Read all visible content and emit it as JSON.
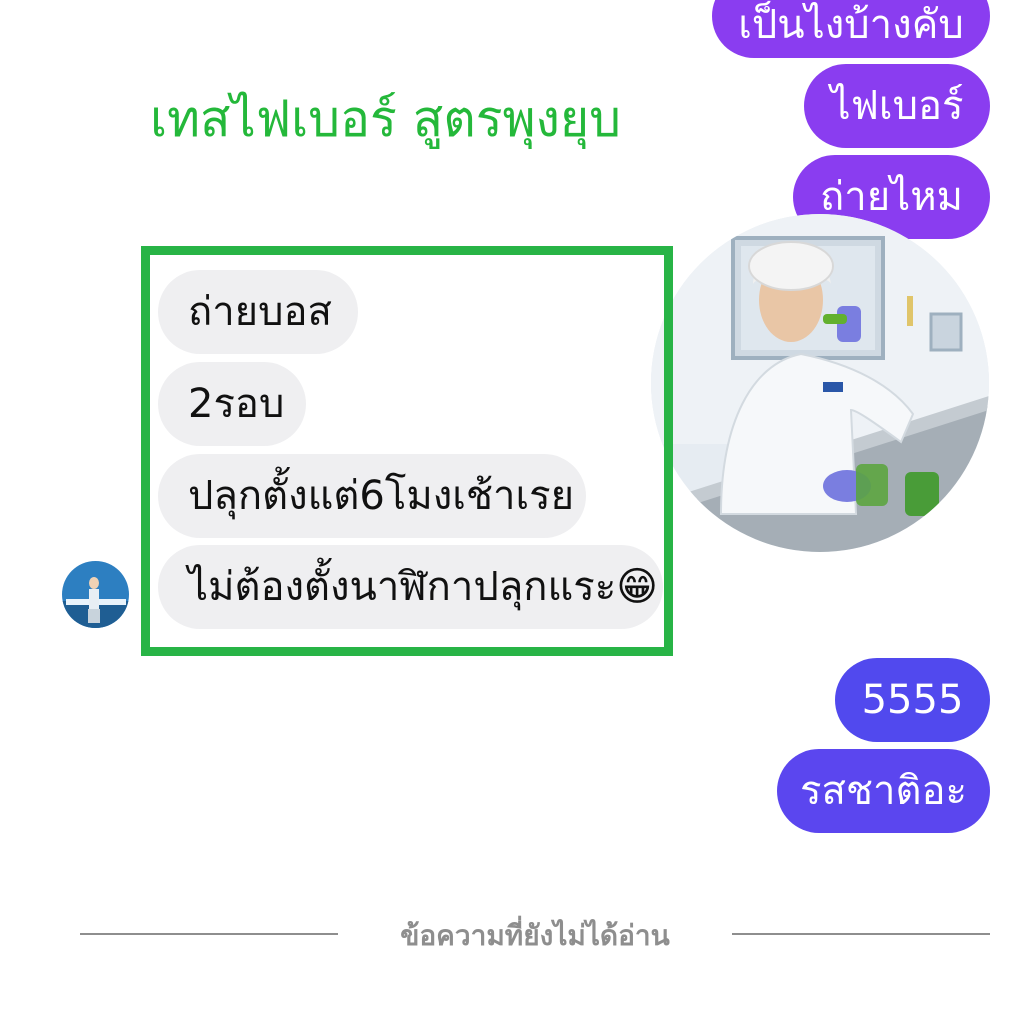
{
  "title": "เทสไฟเบอร์ สูตรพุงยุบ",
  "outgoing_top": [
    {
      "text": "เป็นไงบ้างคับ",
      "color": "#8a3df0"
    },
    {
      "text": "ไฟเบอร์",
      "color": "#8a3df0"
    },
    {
      "text": "ถ่ายไหม",
      "color": "#8a3df0"
    }
  ],
  "incoming": [
    {
      "text": "ถ่ายบอส"
    },
    {
      "text": "2รอบ"
    },
    {
      "text": "ปลุกตั้งแต่6โมงเช้าเรย"
    },
    {
      "text": "ไม่ต้องตั้งนาฬิกาปลุกแระ",
      "emoji": "😁"
    }
  ],
  "outgoing_bottom": [
    {
      "text": "5555",
      "color": "#5149ee"
    },
    {
      "text": "รสชาติอะ",
      "color": "#5b46ef"
    }
  ],
  "unread_divider": "ข้อความที่ยังไม่ได้อ่าน",
  "colors": {
    "title": "#24b83a",
    "highlight_border": "#28b446",
    "incoming_bubble": "#efeff1"
  }
}
